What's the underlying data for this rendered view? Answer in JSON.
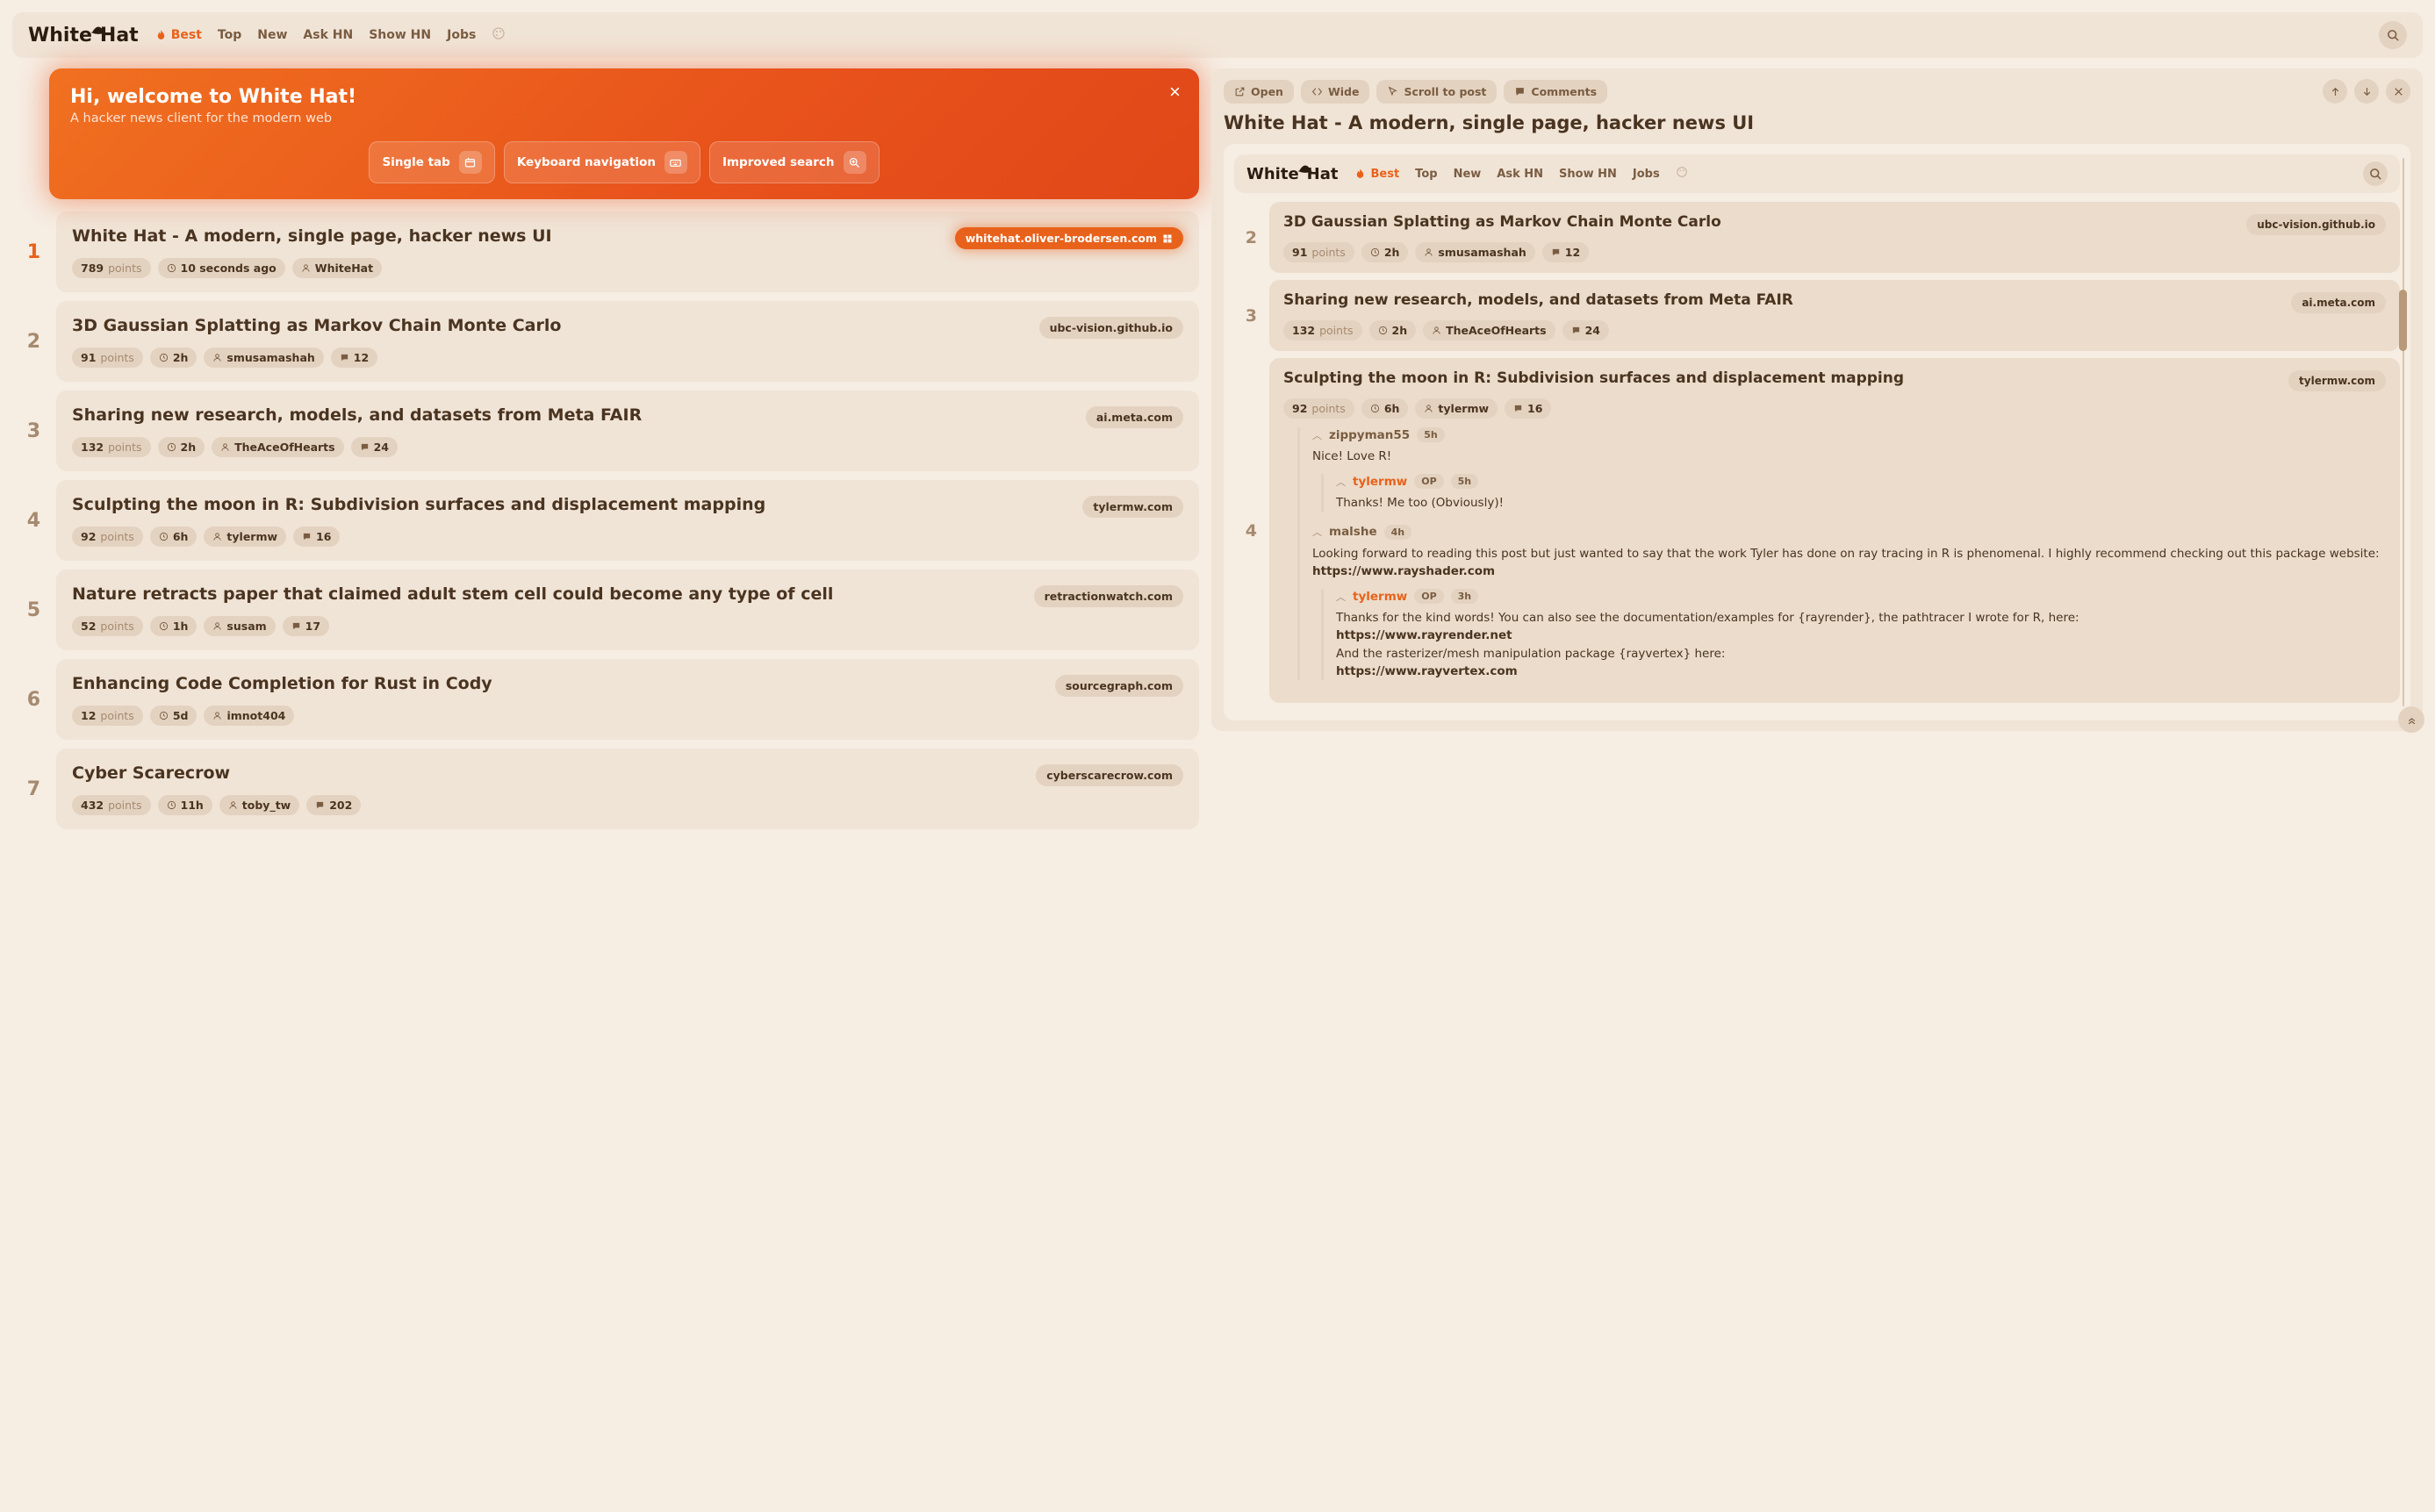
{
  "brand": "WhiteHat",
  "nav": [
    "Best",
    "Top",
    "New",
    "Ask HN",
    "Show HN",
    "Jobs"
  ],
  "active_nav": 0,
  "banner": {
    "title": "Hi, welcome to White Hat!",
    "subtitle": "A hacker news client for the modern web",
    "chips": [
      "Single tab",
      "Keyboard navigation",
      "Improved search"
    ]
  },
  "stories": [
    {
      "rank": "1",
      "title": "White Hat - A modern, single page, hacker news UI",
      "domain": "whitehat.oliver-brodersen.com",
      "hot": true,
      "points": "789",
      "time": "10 seconds ago",
      "user": "WhiteHat",
      "comments": null
    },
    {
      "rank": "2",
      "title": "3D Gaussian Splatting as Markov Chain Monte Carlo",
      "domain": "ubc-vision.github.io",
      "points": "91",
      "time": "2h",
      "user": "smusamashah",
      "comments": "12"
    },
    {
      "rank": "3",
      "title": "Sharing new research, models, and datasets from Meta FAIR",
      "domain": "ai.meta.com",
      "points": "132",
      "time": "2h",
      "user": "TheAceOfHearts",
      "comments": "24"
    },
    {
      "rank": "4",
      "title": "Sculpting the moon in R: Subdivision surfaces and displacement mapping",
      "domain": "tylermw.com",
      "points": "92",
      "time": "6h",
      "user": "tylermw",
      "comments": "16"
    },
    {
      "rank": "5",
      "title": "Nature retracts paper that claimed adult stem cell could become any type of cell",
      "domain": "retractionwatch.com",
      "points": "52",
      "time": "1h",
      "user": "susam",
      "comments": "17"
    },
    {
      "rank": "6",
      "title": "Enhancing Code Completion for Rust in Cody",
      "domain": "sourcegraph.com",
      "points": "12",
      "time": "5d",
      "user": "imnot404",
      "comments": null
    },
    {
      "rank": "7",
      "title": "Cyber Scarecrow",
      "domain": "cyberscarecrow.com",
      "points": "432",
      "time": "11h",
      "user": "toby_tw",
      "comments": "202"
    }
  ],
  "panel": {
    "buttons": [
      "Open",
      "Wide",
      "Scroll to post",
      "Comments"
    ],
    "title": "White Hat - A modern, single page, hacker news UI"
  },
  "preview_stories": [
    {
      "rank": "2",
      "title": "3D Gaussian Splatting as Markov Chain Monte Carlo",
      "domain": "ubc-vision.github.io",
      "points": "91",
      "time": "2h",
      "user": "smusamashah",
      "comments": "12"
    },
    {
      "rank": "3",
      "title": "Sharing new research, models, and datasets from Meta FAIR",
      "domain": "ai.meta.com",
      "points": "132",
      "time": "2h",
      "user": "TheAceOfHearts",
      "comments": "24"
    },
    {
      "rank": "4",
      "title": "Sculpting the moon in R: Subdivision surfaces and displacement mapping",
      "domain": "tylermw.com",
      "points": "92",
      "time": "6h",
      "user": "tylermw",
      "comments": "16"
    }
  ],
  "preview_comments": [
    {
      "user": "zippyman55",
      "op": false,
      "time": "5h",
      "body": "Nice! Love R!",
      "replies": [
        {
          "user": "tylermw",
          "op": true,
          "time": "5h",
          "body": "Thanks! Me too (Obviously)!"
        }
      ]
    },
    {
      "user": "malshe",
      "op": false,
      "time": "4h",
      "body": "Looking forward to reading this post but just wanted to say that the work Tyler has done on ray tracing in R is phenomenal. I highly recommend checking out this package website: ",
      "link": "https://www.rayshader.com",
      "replies": [
        {
          "user": "tylermw",
          "op": true,
          "time": "3h",
          "body_lines": [
            "Thanks for the kind words! You can also see the documentation/examples for {rayrender}, the pathtracer I wrote for R, here:",
            "https://www.rayrender.net",
            "And the rasterizer/mesh manipulation package {rayvertex} here:",
            "https://www.rayvertex.com"
          ]
        }
      ]
    }
  ],
  "labels": {
    "points": "points",
    "op": "OP"
  }
}
